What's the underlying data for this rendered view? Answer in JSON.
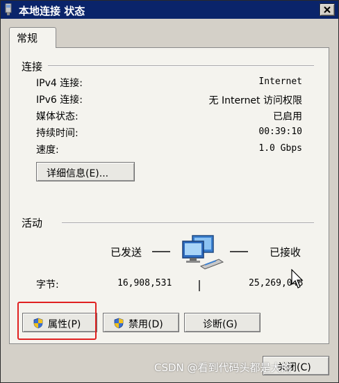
{
  "window": {
    "title": "本地连接 状态",
    "close_label": "×"
  },
  "tabs": [
    {
      "label": "常规",
      "selected": true
    }
  ],
  "connection": {
    "group_label": "连接",
    "rows": [
      {
        "label": "IPv4 连接:",
        "value": "Internet"
      },
      {
        "label": "IPv6 连接:",
        "value": "无 Internet 访问权限"
      },
      {
        "label": "媒体状态:",
        "value": "已启用"
      },
      {
        "label": "持续时间:",
        "value": "00:39:10"
      },
      {
        "label": "速度:",
        "value": "1.0 Gbps"
      }
    ],
    "details_button": "详细信息(E)..."
  },
  "activity": {
    "group_label": "活动",
    "sent_label": "已发送",
    "received_label": "已接收",
    "bytes_label": "字节:",
    "bytes_sent": "16,908,531",
    "bytes_received": "25,269,048",
    "icon": "network-computers-icon"
  },
  "buttons": {
    "properties": "属性(P)",
    "disable": "禁用(D)",
    "diagnose": "诊断(G)",
    "close": "关闭(C)"
  },
  "watermark": "CSDN @看到代码头都是大的",
  "colors": {
    "titlebar": "#0a246a",
    "dialog_bg": "#d4d0c8",
    "panel_bg": "#f4f3ee",
    "highlight_box": "#e02020"
  }
}
